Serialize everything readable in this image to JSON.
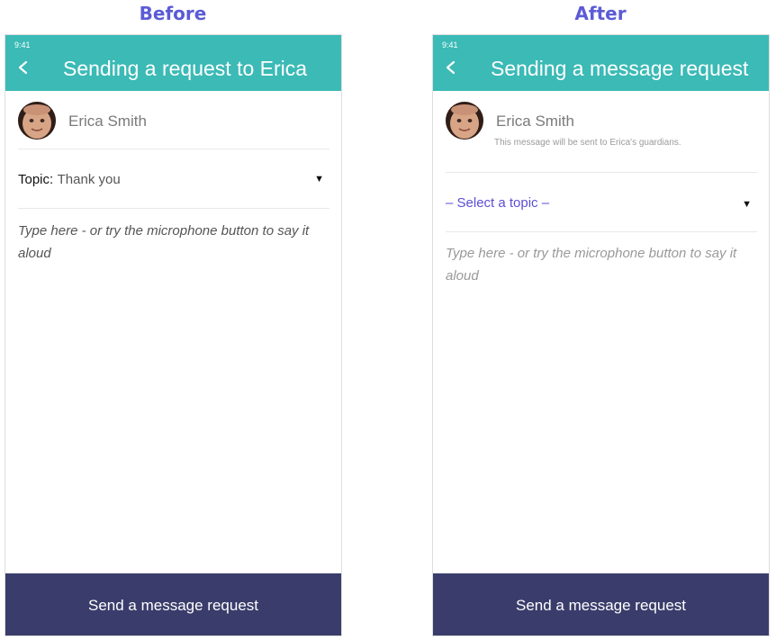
{
  "captions": {
    "before": "Before",
    "after": "After"
  },
  "before": {
    "status_time": "9:41",
    "header_title": "Sending a request to Erica",
    "recipient_name": "Erica Smith",
    "topic_label": "Topic:",
    "topic_value": "Thank you",
    "dropdown_icon": "▼",
    "message_placeholder": "Type here - or try the microphone button to say it aloud",
    "send_button": "Send a message request"
  },
  "after": {
    "status_time": "9:41",
    "header_title": "Sending a message request",
    "recipient_name": "Erica Smith",
    "recipient_note": "This message will be sent to Erica's guardians.",
    "topic_placeholder": "– Select a topic –",
    "dropdown_icon": "▼",
    "message_placeholder": "Type here - or try the microphone button to say it aloud",
    "send_button": "Send a message request"
  },
  "colors": {
    "header": "#3bbab6",
    "footer": "#3a3d6b",
    "caption": "#5b5bd6",
    "topic_placeholder": "#5b4fd6"
  }
}
